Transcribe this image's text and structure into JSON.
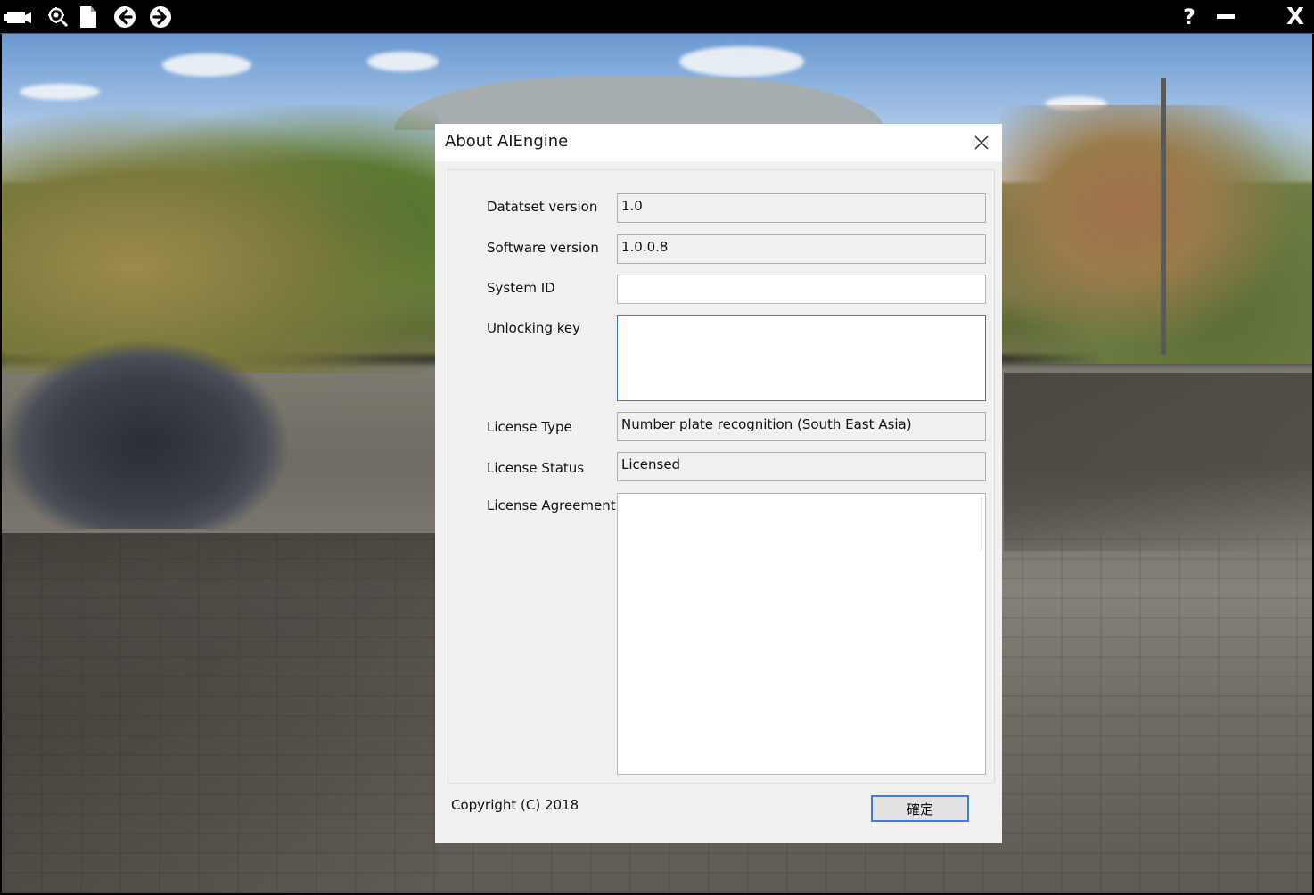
{
  "toolbar": {
    "icons": [
      "camera-icon",
      "zoom-settings-icon",
      "document-icon",
      "back-arrow-icon",
      "forward-arrow-icon"
    ],
    "help_label": "?",
    "minimize_label": "–",
    "close_label": "X"
  },
  "dialog": {
    "title": "About AIEngine",
    "fields": {
      "dataset_version": {
        "label": "Datatset version",
        "value": "1.0"
      },
      "software_version": {
        "label": "Software version",
        "value": "1.0.0.8"
      },
      "system_id": {
        "label": "System ID",
        "value": ""
      },
      "unlocking_key": {
        "label": "Unlocking key",
        "value": ""
      },
      "license_type": {
        "label": "License Type",
        "value": "Number plate recognition (South East Asia)"
      },
      "license_status": {
        "label": "License Status",
        "value": "Licensed"
      },
      "license_agreement": {
        "label": "License Agreement",
        "value": ""
      }
    },
    "copyright": "Copyright (C) 2018",
    "ok_label": "確定"
  },
  "colors": {
    "toolbar_bg": "#000000",
    "dialog_bg": "#f0f0f0",
    "focus_border": "#3d7bc8",
    "ok_border": "#3c7fcf"
  }
}
